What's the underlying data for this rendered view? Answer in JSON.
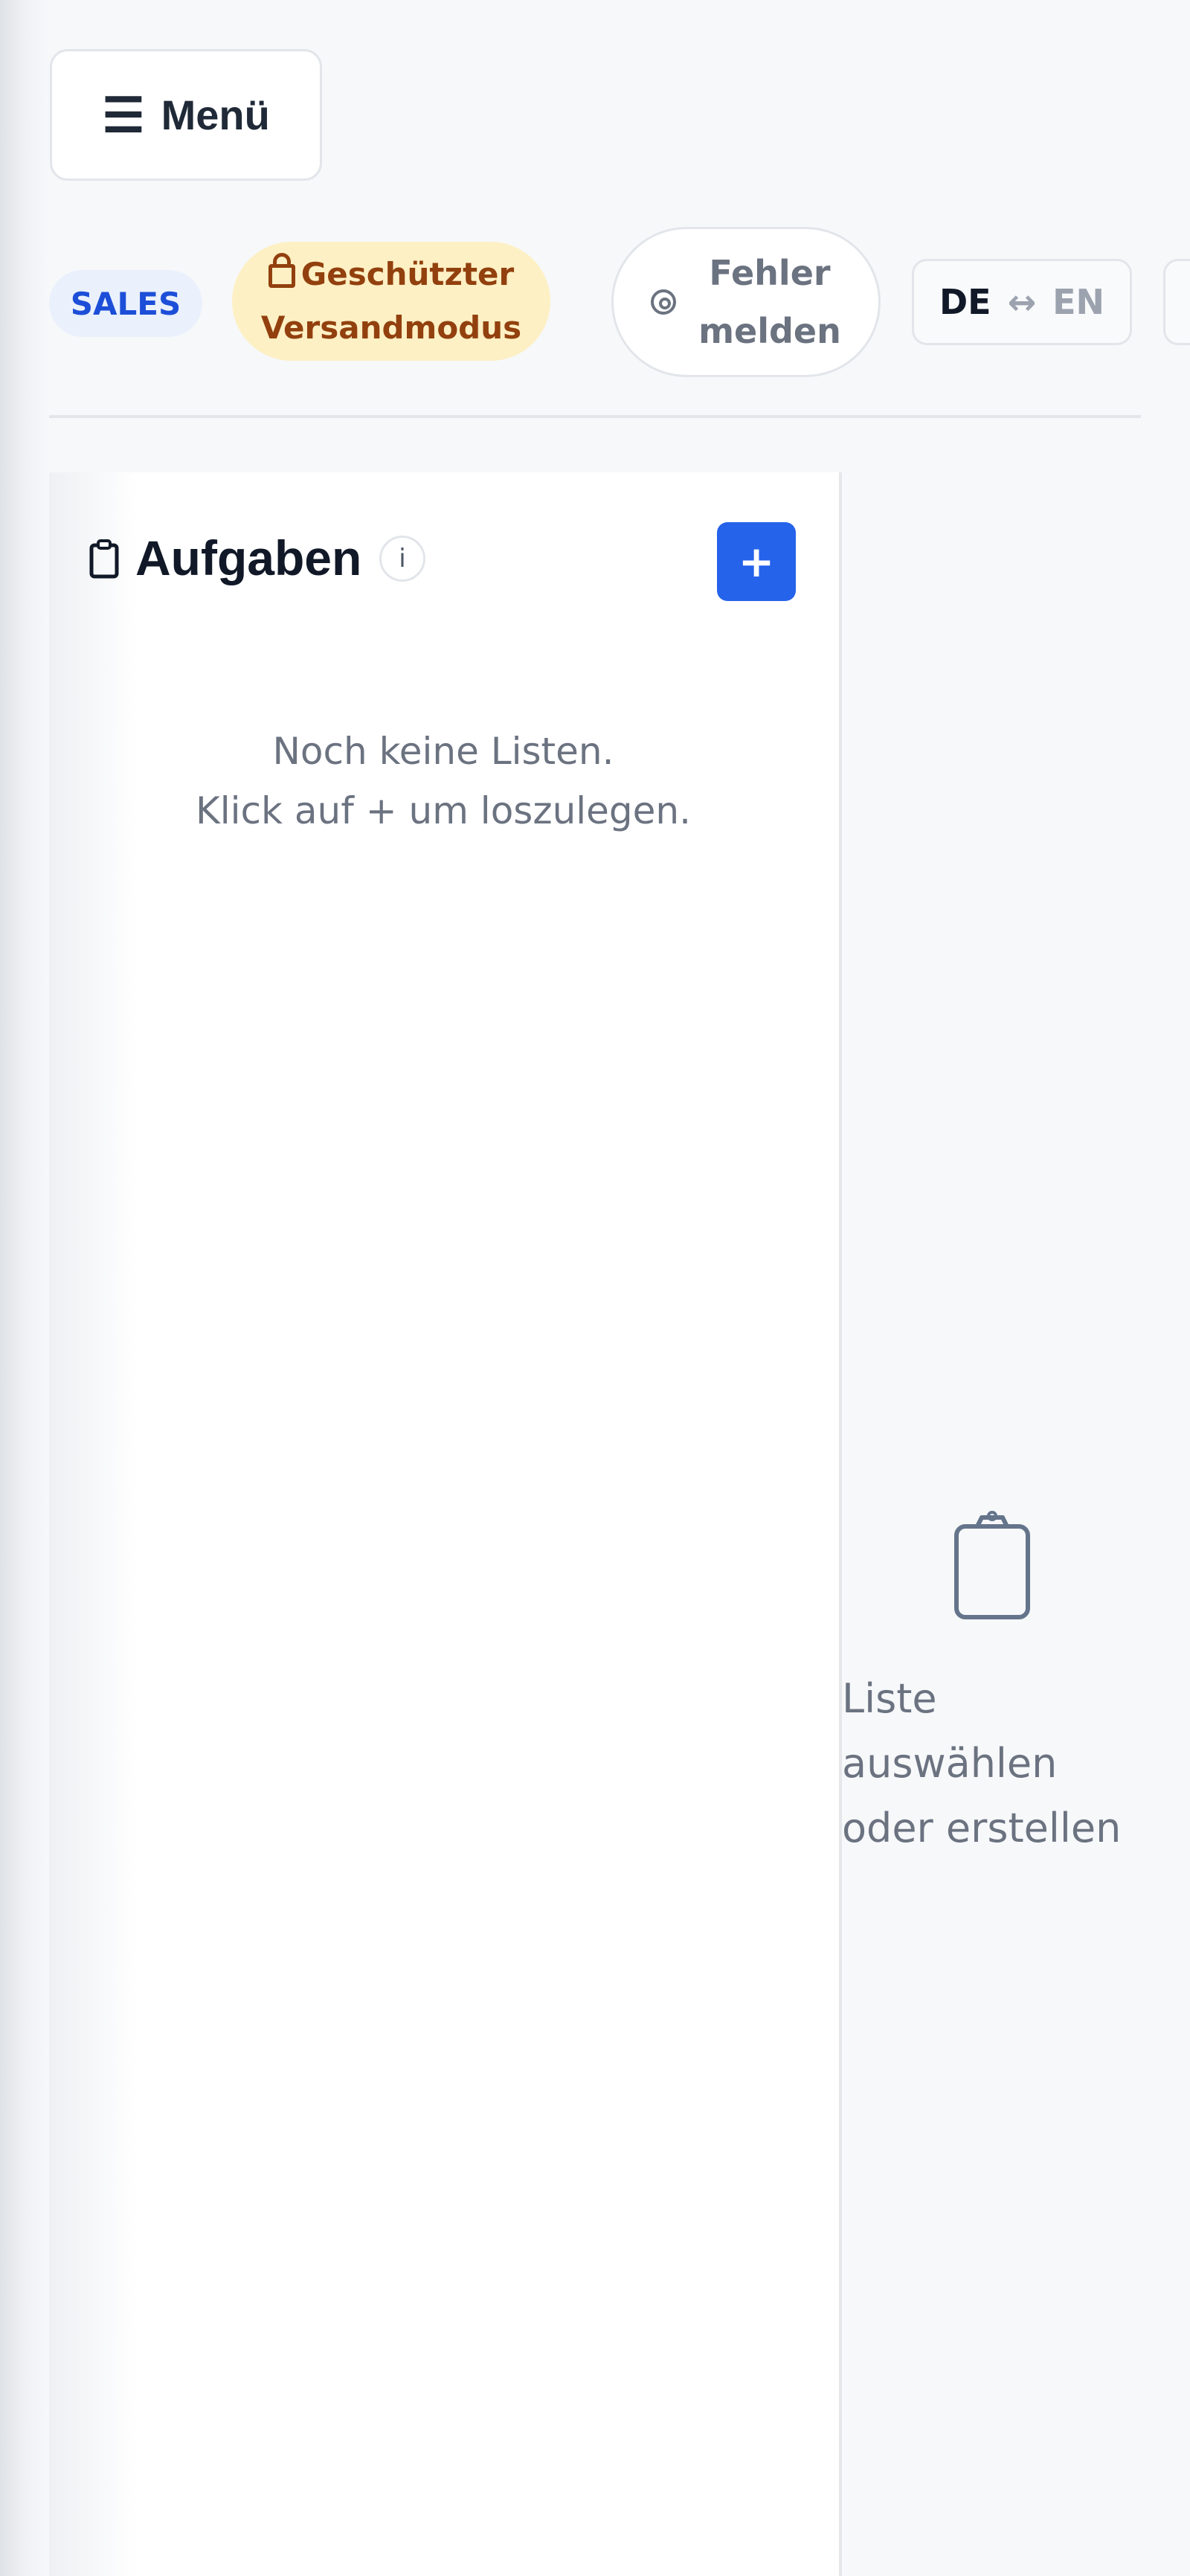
{
  "header": {
    "menu_label": "Menü",
    "menu_icon": "☰"
  },
  "toolbar": {
    "role_badge": "SALES",
    "protected_line1": "Geschützter",
    "protected_line2": "Versandmodus",
    "bug_line1": "Fehler",
    "bug_line2": "melden",
    "lang_active": "DE",
    "lang_arrow": "↔",
    "lang_other": "EN"
  },
  "tasks": {
    "title": "Aufgaben",
    "info": "i",
    "add_label": "+",
    "empty_line1": "Noch keine Listen.",
    "empty_line2": "Klick auf + um loszulegen."
  },
  "detail": {
    "empty_line1": "Liste",
    "empty_line2": "auswählen",
    "empty_line3": "oder erstellen"
  },
  "icons": {
    "menu": "hamburger-icon",
    "lock": "lock-icon",
    "bug": "lifebuoy-icon",
    "clipboard": "clipboard-icon",
    "info": "info-icon"
  },
  "colors": {
    "accent": "#2563eb",
    "badge_blue_text": "#1d4ed8",
    "badge_blue_bg": "#eaf1fc",
    "warn_text": "#92400e",
    "warn_bg": "#fdf0c4",
    "muted_text": "#6b7280"
  }
}
